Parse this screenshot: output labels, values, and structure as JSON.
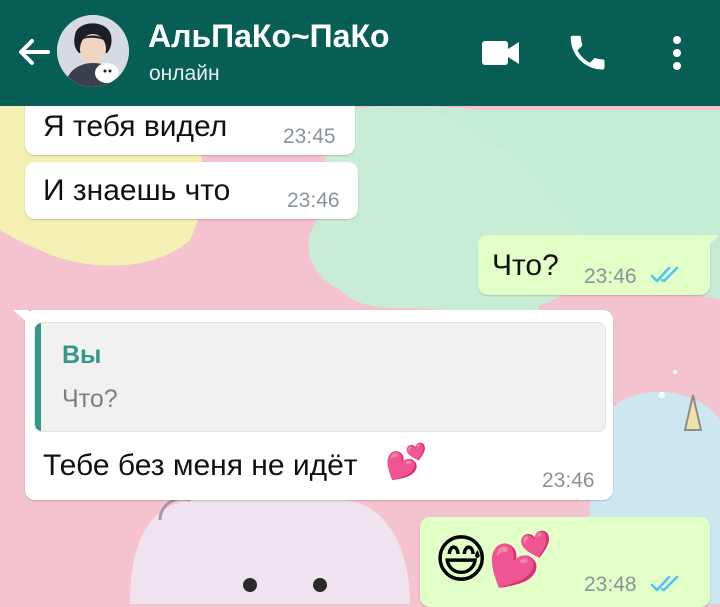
{
  "header": {
    "contact_name": "АльПаКо~ПаКо",
    "status": "онлайн",
    "icons": [
      "back-arrow-icon",
      "video-call-icon",
      "phone-call-icon",
      "more-vert-icon"
    ]
  },
  "colors": {
    "header_bg": "#075e54",
    "incoming_bubble": "#ffffff",
    "outgoing_bubble": "#e2ffc7",
    "read_ticks": "#4fc3f7",
    "quote_accent": "#35978a"
  },
  "messages": [
    {
      "direction": "in",
      "text": "Я тебя видел",
      "time": "23:45"
    },
    {
      "direction": "in",
      "text": "И знаешь что",
      "time": "23:46"
    },
    {
      "direction": "out",
      "text": "Что?",
      "time": "23:46",
      "status": "read"
    },
    {
      "direction": "in",
      "text": "Тебе без меня не идёт",
      "time": "23:46",
      "emoji": "💕",
      "reply_to": {
        "author": "Вы",
        "text": "Что?"
      }
    },
    {
      "direction": "out",
      "text": "😅💕",
      "time": "23:48",
      "status": "read"
    }
  ]
}
